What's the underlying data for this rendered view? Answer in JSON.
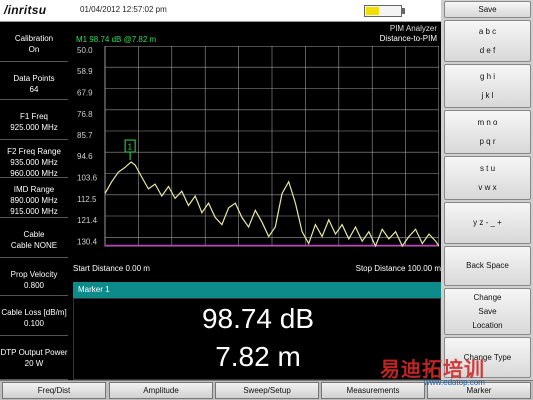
{
  "header": {
    "logo": "/inritsu",
    "datetime": "01/04/2012 12:57:02 pm",
    "battery_level": 0.35,
    "analyzer_title": "PIM Analyzer",
    "mode": "Distance-to-PIM",
    "marker_readout": "M1  98.74 dB @7.82 m"
  },
  "left_panel": [
    {
      "label": "Calibration",
      "value": "On"
    },
    {
      "label": "Data Points",
      "value": "64"
    },
    {
      "label": "F1 Freq",
      "value": "925.000 MHz"
    },
    {
      "label": "F2 Freq Range",
      "value": "935.000 MHz",
      "value2": "960.000 MHz"
    },
    {
      "label": "IMD Range",
      "value": "890.000 MHz",
      "value2": "915.000 MHz"
    },
    {
      "label": "Cable",
      "value": "Cable NONE"
    },
    {
      "label": "Prop Velocity",
      "value": "0.800"
    },
    {
      "label": "Cable Loss [dB/m]",
      "value": "0.100"
    },
    {
      "label": "DTP Output Power",
      "value": "20 W"
    }
  ],
  "softkeys": [
    {
      "line1": "Save"
    },
    {
      "line1": "a b c",
      "line2": "d e f"
    },
    {
      "line1": "g h i",
      "line2": "j k l"
    },
    {
      "line1": "m n o",
      "line2": "p q r"
    },
    {
      "line1": "s t u",
      "line2": "v w x"
    },
    {
      "line1": "y z - _ +"
    },
    {
      "line1": "Back Space"
    },
    {
      "line1": "Change",
      "line2": "Save",
      "line3": "Location"
    },
    {
      "line1": "Change Type"
    }
  ],
  "bottom_menu": [
    "Freq/Dist",
    "Amplitude",
    "Sweep/Setup",
    "Measurements",
    "Marker"
  ],
  "graph": {
    "start_distance": "Start Distance 0.00 m",
    "stop_distance": "Stop Distance 100.00 m",
    "marker_label": "1",
    "colors": {
      "trace": "#e8e8a0",
      "grid": "#9a9a9a",
      "baseline": "#c040c0",
      "marker": "#33dd55"
    }
  },
  "chart_data": {
    "type": "line",
    "xlabel": "",
    "ylabel": "",
    "xlim": [
      0,
      100
    ],
    "ylim": [
      50.0,
      134
    ],
    "y_inverted": true,
    "yticks": [
      "50.0",
      "58.9",
      "67.9",
      "76.8",
      "85.7",
      "94.6",
      "103.6",
      "112.5",
      "121.4",
      "130.4"
    ],
    "series": [
      {
        "x": [
          0,
          2,
          4,
          6,
          7.82,
          9,
          11,
          13,
          15,
          17,
          19,
          21,
          23,
          25,
          27,
          29,
          31,
          33,
          35,
          37,
          39,
          41,
          43,
          45,
          47,
          49,
          51,
          53,
          55,
          57,
          59,
          61,
          63,
          65,
          67,
          69,
          71,
          73,
          75,
          77,
          79,
          81,
          83,
          85,
          87,
          89,
          91,
          93,
          95,
          97,
          99,
          100
        ],
        "y": [
          112,
          107,
          103,
          101,
          98.74,
          100,
          105,
          110,
          108,
          113,
          109,
          114,
          111,
          117,
          113,
          120,
          116,
          122,
          125,
          118,
          116,
          122,
          126,
          119,
          124,
          130,
          126,
          112,
          107,
          116,
          128,
          133,
          125,
          130,
          123,
          129,
          125,
          131,
          126,
          132,
          128,
          134,
          127,
          131,
          128,
          134,
          130,
          127,
          133,
          129,
          132,
          134
        ]
      }
    ],
    "marker": {
      "x": 7.82,
      "y": 98.74,
      "label": "1"
    }
  },
  "marker_table": {
    "header": "Marker 1",
    "value_db": "98.74 dB",
    "value_m": "7.82 m"
  },
  "watermark": {
    "text": "易迪拓培训",
    "url": "www.edatop.com"
  }
}
